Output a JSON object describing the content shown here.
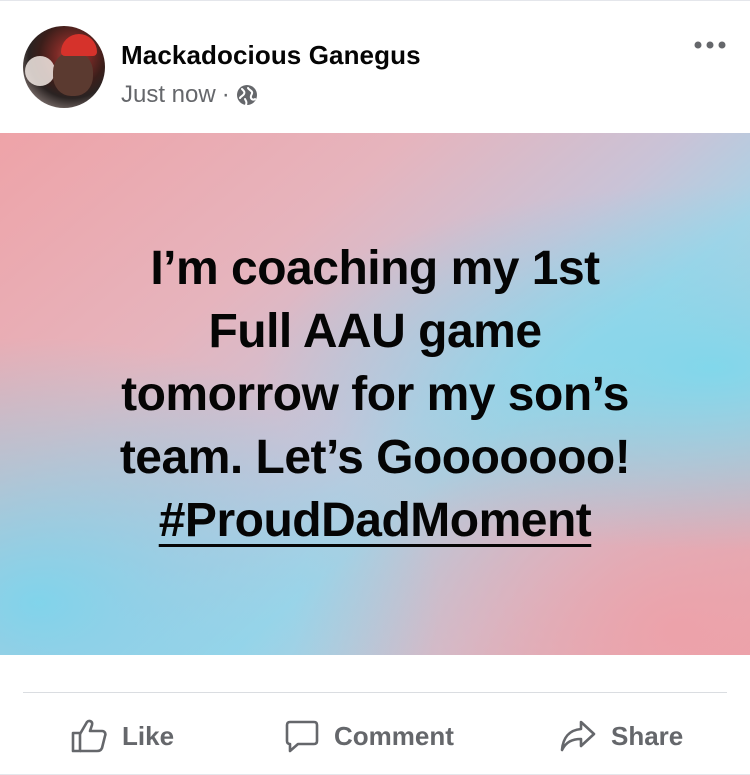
{
  "post": {
    "author_name": "Mackadocious Ganegus",
    "timestamp": "Just now",
    "separator": "·",
    "privacy_icon": "globe-icon",
    "more_icon": "more-options-icon",
    "text_lines": [
      "I’m coaching my 1st",
      "Full AAU game",
      "tomorrow for my son’s",
      "team. Let’s Gooooooo!"
    ],
    "hashtag": "#ProudDadMoment",
    "background_colors": [
      "#eea3a8",
      "#a9d3e6",
      "#7ed8ec"
    ]
  },
  "actions": {
    "like_label": "Like",
    "comment_label": "Comment",
    "share_label": "Share",
    "like_icon": "thumbs-up-icon",
    "comment_icon": "speech-bubble-icon",
    "share_icon": "share-arrow-icon",
    "icon_color": "#65676b"
  }
}
